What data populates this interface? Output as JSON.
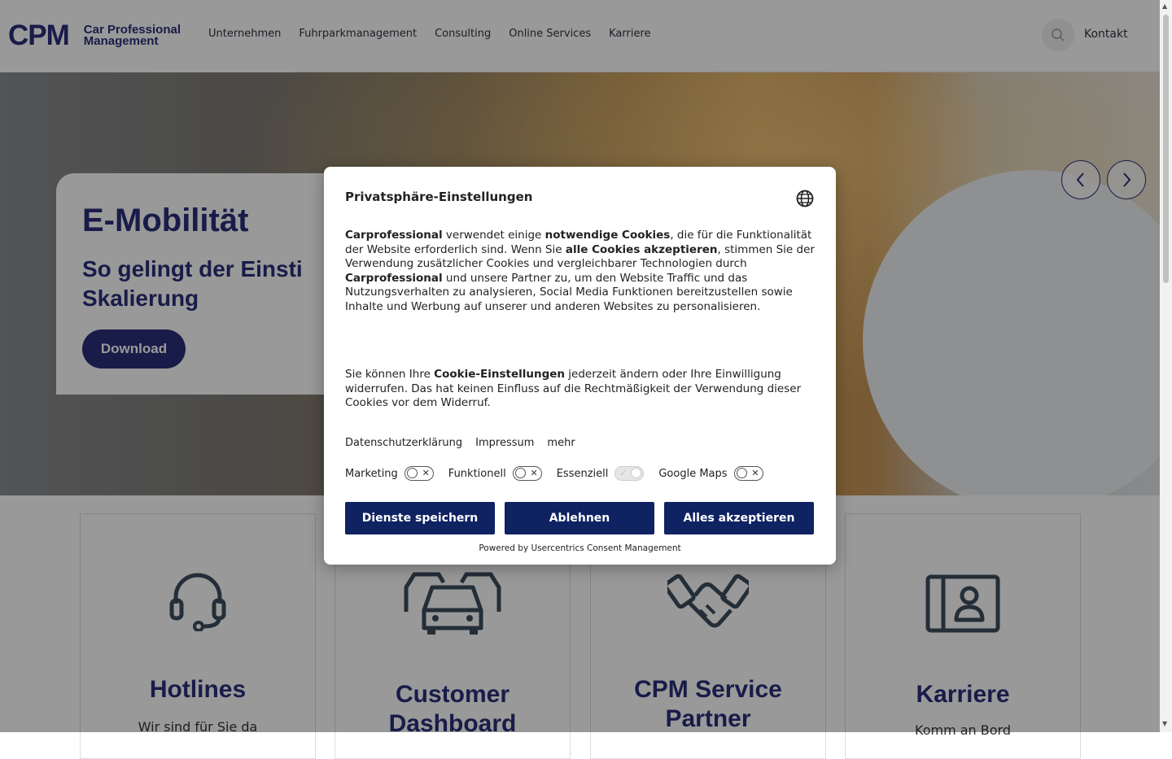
{
  "header": {
    "logo_cpm": "CPM",
    "logo_line1": "Car Professional",
    "logo_line2": "Management",
    "nav": [
      "Unternehmen",
      "Fuhrparkmanagement",
      "Consulting",
      "Online Services",
      "Karriere"
    ],
    "kontakt": "Kontakt"
  },
  "hero": {
    "title": "E-Mobilität",
    "subtitle_line1": "So gelingt der Einsti",
    "subtitle_line2": "Skalierung",
    "button": "Download"
  },
  "cards": [
    {
      "title": "Hotlines",
      "text": "Wir sind für Sie da"
    },
    {
      "title_line1": "Customer",
      "title_line2": "Dashboard"
    },
    {
      "title_line1": "CPM Service",
      "title_line2": "Partner"
    },
    {
      "title": "Karriere",
      "text": "Komm an Bord"
    }
  ],
  "dialog": {
    "title": "Privatsphäre-Einstellungen",
    "para1": {
      "b1": "Carprofessional",
      "t1": " verwendet einige ",
      "b2": "notwendige Cookies",
      "t2": ", die für die Funktionalität der Website erforderlich sind. Wenn Sie ",
      "b3": "alle Cookies akzeptieren",
      "t3": ", stimmen Sie der Verwendung zusätzlicher Cookies und vergleichbarer Technologien durch ",
      "b4": "Carprofessional",
      "t4": " und unsere Partner zu, um den Website Traffic und das Nutzungsverhalten zu analysieren, Social Media Funktionen bereitzustellen sowie Inhalte und Werbung auf unserer und anderen Websites zu personalisieren."
    },
    "para2": {
      "t1": "Sie können Ihre ",
      "b1": "Cookie-Einstellungen",
      "t2": " jederzeit ändern oder Ihre Einwilligung widerrufen. Das hat keinen Einfluss auf die Rechtmäßigkeit der Verwendung dieser Cookies vor dem Widerruf."
    },
    "links": [
      "Datenschutzerklärung",
      "Impressum",
      "mehr"
    ],
    "toggles": [
      {
        "label": "Marketing",
        "state": "off"
      },
      {
        "label": "Funktionell",
        "state": "off"
      },
      {
        "label": "Essenziell",
        "state": "on-disabled"
      },
      {
        "label": "Google Maps",
        "state": "off"
      }
    ],
    "buttons": [
      "Dienste speichern",
      "Ablehnen",
      "Alles akzeptieren"
    ],
    "powered_by": "Powered by Usercentrics Consent Management"
  },
  "colors": {
    "brand": "#2b2f7a",
    "dialog_button": "#0f2363"
  }
}
